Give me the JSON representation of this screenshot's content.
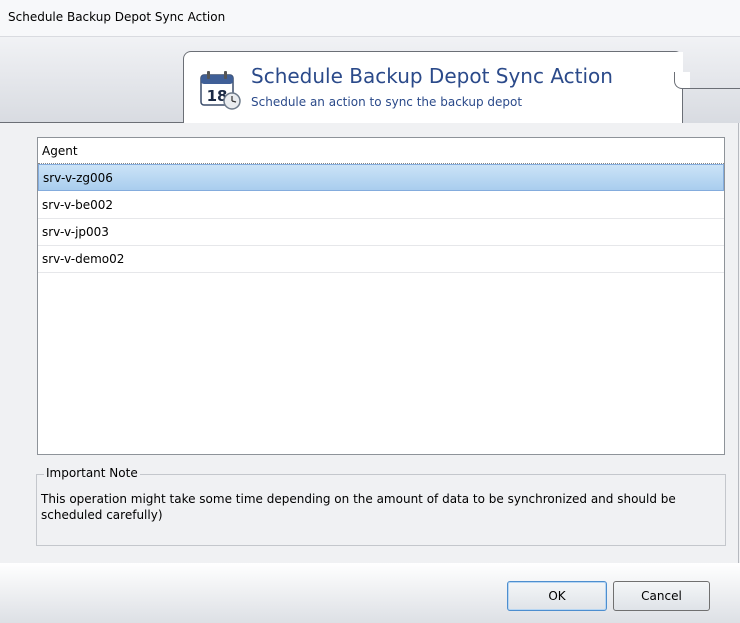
{
  "window": {
    "title": "Schedule Backup Depot Sync Action"
  },
  "header": {
    "title": "Schedule Backup Depot Sync Action",
    "subtitle": "Schedule an action to sync the backup depot",
    "icon": "calendar-icon",
    "calendar_day": "18"
  },
  "agent_list": {
    "column_header": "Agent",
    "selected_index": 0,
    "rows": [
      {
        "agent": "srv-v-zg006"
      },
      {
        "agent": "srv-v-be002"
      },
      {
        "agent": "srv-v-jp003"
      },
      {
        "agent": "srv-v-demo02"
      }
    ]
  },
  "note": {
    "legend": "Important Note",
    "text": "This operation might take some time depending on the amount of data to be synchronized and should be scheduled carefully)"
  },
  "buttons": {
    "ok_label": "OK",
    "cancel_label": "Cancel"
  },
  "colors": {
    "header_text": "#2b4a8a",
    "selection": "#a9cdee"
  }
}
